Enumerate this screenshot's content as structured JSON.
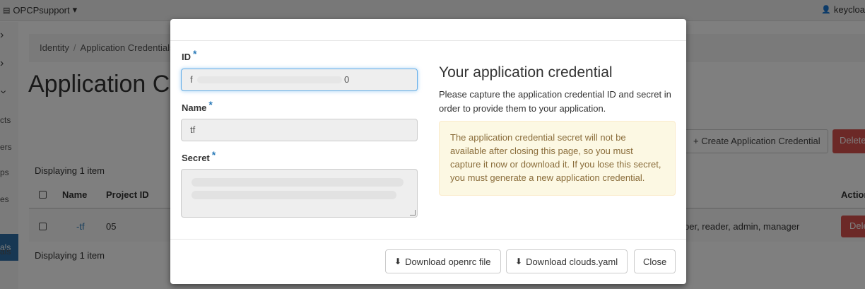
{
  "topbar": {
    "project": "OPCPsupport",
    "project_caret": "▾",
    "user": "keycloa"
  },
  "sidebar": {
    "items": [
      "cts",
      "ers",
      "ps",
      "es"
    ],
    "active": "als",
    "last": "als"
  },
  "breadcrumb": {
    "items": [
      "Identity",
      "Application Credentials"
    ]
  },
  "page": {
    "title": "Application Credentials",
    "create_button": "+ Create Application Credential",
    "delete_button": "Delete",
    "displaying": "Displaying 1 item"
  },
  "table": {
    "columns": [
      "Name",
      "Project ID",
      "Actions"
    ],
    "row": {
      "name": "-tf",
      "project_id": "05",
      "roles": "per, reader, admin, manager",
      "action": "Delete"
    }
  },
  "modal": {
    "fields": {
      "id_label": "ID",
      "id_value_start": "f",
      "id_value_end": "0",
      "name_label": "Name",
      "name_value": "tf",
      "secret_label": "Secret",
      "required_marker": "*"
    },
    "info": {
      "title": "Your application credential",
      "text": "Please capture the application credential ID and secret in order to provide them to your application.",
      "warning": "The application credential secret will not be available after closing this page, so you must capture it now or download it. If you lose this secret, you must generate a new application credential."
    },
    "footer": {
      "download_openrc": "Download openrc file",
      "download_clouds": "Download clouds.yaml",
      "close": "Close"
    }
  },
  "colors": {
    "accent": "#2a7ab8",
    "danger": "#d9534f",
    "warning_bg": "#fcf8e3",
    "warning_text": "#8a6d3b"
  }
}
